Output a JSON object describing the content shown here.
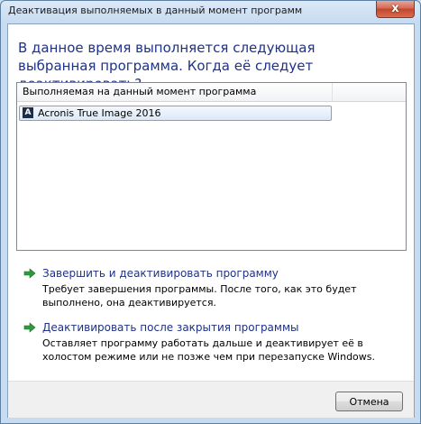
{
  "window": {
    "title": "Деактивация выполняемых в данный момент программ",
    "close_glyph": "x"
  },
  "heading": "В данное время выполняется следующая выбранная программа. Когда её следует деактивировать?",
  "list": {
    "column_header": "Выполняемая на данный момент программа",
    "items": [
      {
        "icon": "acronis-app-icon",
        "icon_glyph": "A",
        "label": "Acronis True Image 2016",
        "selected": true
      }
    ]
  },
  "options": [
    {
      "icon": "green-arrow-icon",
      "title": "Завершить и деактивировать программу",
      "description": "Требует завершения программы. После того, как это будет выполнено, она деактивируется."
    },
    {
      "icon": "green-arrow-icon",
      "title": "Деактивировать после закрытия программы",
      "description": "Оставляет программу работать дальше и деактивирует её в холостом режиме или не позже чем при перезапуске Windows."
    }
  ],
  "footer": {
    "cancel_label": "Отмена"
  },
  "colors": {
    "link_blue": "#1e3287",
    "arrow_green": "#2a9d3a",
    "close_red": "#c2452c"
  }
}
